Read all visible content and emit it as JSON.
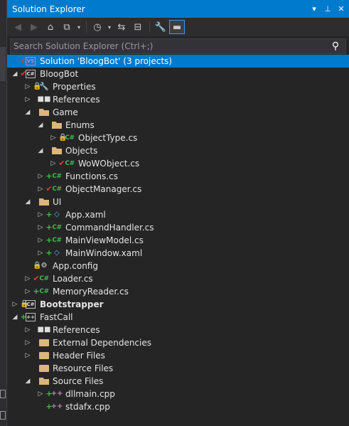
{
  "window": {
    "title": "Solution Explorer",
    "dropdown_glyph": "▾",
    "pin_glyph": "⊥",
    "close_glyph": "✕"
  },
  "toolbar": {
    "back_glyph": "◀",
    "forward_glyph": "▶",
    "home_glyph": "⌂",
    "switch_views_glyph": "⧉",
    "dropdown_glyph": "▾",
    "pending_changes_glyph": "◷",
    "sync_glyph": "⇆",
    "collapse_glyph": "⊟",
    "properties_glyph": "🔧",
    "preview_glyph": "▬"
  },
  "search": {
    "placeholder": "Search Solution Explorer (Ctrl+;)",
    "icon_glyph": "⚲"
  },
  "tree": {
    "rows": [
      {
        "text": "Solution 'BloogBot' (3 projects)",
        "depth": 0,
        "expander": "",
        "indicator": "✔",
        "indicator_kind": "check",
        "icon": "sol",
        "icon_text": "VS",
        "selected": true
      },
      {
        "text": "BloogBot",
        "depth": 0,
        "expander": "◢",
        "indicator": "✔",
        "indicator_kind": "check",
        "icon": "proj",
        "icon_text": "C#"
      },
      {
        "text": "Properties",
        "depth": 1,
        "expander": "▷",
        "indicator": "🔒",
        "indicator_kind": "lock",
        "icon": "wrench",
        "icon_text": "🔧"
      },
      {
        "text": "References",
        "depth": 1,
        "expander": "▷",
        "indicator": "",
        "indicator_kind": "",
        "icon": "refs",
        "icon_text": "■■"
      },
      {
        "text": "Game",
        "depth": 1,
        "expander": "◢",
        "indicator": "",
        "indicator_kind": "",
        "icon": "folder-open",
        "icon_text": ""
      },
      {
        "text": "Enums",
        "depth": 2,
        "expander": "◢",
        "indicator": "",
        "indicator_kind": "",
        "icon": "folder-open",
        "icon_text": ""
      },
      {
        "text": "ObjectType.cs",
        "depth": 3,
        "expander": "▷",
        "indicator": "🔒",
        "indicator_kind": "lock",
        "icon": "cs",
        "icon_text": "C#"
      },
      {
        "text": "Objects",
        "depth": 2,
        "expander": "◢",
        "indicator": "",
        "indicator_kind": "",
        "icon": "folder-open",
        "icon_text": ""
      },
      {
        "text": "WoWObject.cs",
        "depth": 3,
        "expander": "▷",
        "indicator": "✔",
        "indicator_kind": "check",
        "icon": "cs",
        "icon_text": "C#"
      },
      {
        "text": "Functions.cs",
        "depth": 2,
        "expander": "▷",
        "indicator": "+",
        "indicator_kind": "plus",
        "icon": "cs",
        "icon_text": "C#"
      },
      {
        "text": "ObjectManager.cs",
        "depth": 2,
        "expander": "▷",
        "indicator": "✔",
        "indicator_kind": "check",
        "icon": "cs",
        "icon_text": "C#"
      },
      {
        "text": "UI",
        "depth": 1,
        "expander": "◢",
        "indicator": "",
        "indicator_kind": "",
        "icon": "folder-open",
        "icon_text": ""
      },
      {
        "text": "App.xaml",
        "depth": 2,
        "expander": "▷",
        "indicator": "+",
        "indicator_kind": "plus",
        "icon": "xaml",
        "icon_text": "◇"
      },
      {
        "text": "CommandHandler.cs",
        "depth": 2,
        "expander": "▷",
        "indicator": "+",
        "indicator_kind": "plus",
        "icon": "cs",
        "icon_text": "C#"
      },
      {
        "text": "MainViewModel.cs",
        "depth": 2,
        "expander": "▷",
        "indicator": "+",
        "indicator_kind": "plus",
        "icon": "cs",
        "icon_text": "C#"
      },
      {
        "text": "MainWindow.xaml",
        "depth": 2,
        "expander": "▷",
        "indicator": "+",
        "indicator_kind": "plus",
        "icon": "xaml",
        "icon_text": "◇"
      },
      {
        "text": "App.config",
        "depth": 1,
        "expander": "",
        "indicator": "🔒",
        "indicator_kind": "lock",
        "icon": "cfg",
        "icon_text": "⚙"
      },
      {
        "text": "Loader.cs",
        "depth": 1,
        "expander": "▷",
        "indicator": "✔",
        "indicator_kind": "check",
        "icon": "cs",
        "icon_text": "C#"
      },
      {
        "text": "MemoryReader.cs",
        "depth": 1,
        "expander": "▷",
        "indicator": "+",
        "indicator_kind": "plus",
        "icon": "cs",
        "icon_text": "C#"
      },
      {
        "text": "Bootstrapper",
        "depth": 0,
        "expander": "▷",
        "indicator": "🔒",
        "indicator_kind": "lock",
        "icon": "proj",
        "icon_text": "C#",
        "bold": true
      },
      {
        "text": "FastCall",
        "depth": 0,
        "expander": "◢",
        "indicator": "+",
        "indicator_kind": "plus",
        "icon": "proj",
        "icon_text": "++"
      },
      {
        "text": "References",
        "depth": 1,
        "expander": "▷",
        "indicator": "",
        "indicator_kind": "",
        "icon": "refs",
        "icon_text": "■■"
      },
      {
        "text": "External Dependencies",
        "depth": 1,
        "expander": "▷",
        "indicator": "",
        "indicator_kind": "",
        "icon": "folder",
        "icon_text": ""
      },
      {
        "text": "Header Files",
        "depth": 1,
        "expander": "▷",
        "indicator": "",
        "indicator_kind": "",
        "icon": "folder",
        "icon_text": ""
      },
      {
        "text": "Resource Files",
        "depth": 1,
        "expander": "",
        "indicator": "",
        "indicator_kind": "",
        "icon": "folder",
        "icon_text": ""
      },
      {
        "text": "Source Files",
        "depth": 1,
        "expander": "◢",
        "indicator": "",
        "indicator_kind": "",
        "icon": "folder-open",
        "icon_text": ""
      },
      {
        "text": "dllmain.cpp",
        "depth": 2,
        "expander": "▷",
        "indicator": "+",
        "indicator_kind": "plus",
        "icon": "cpp",
        "icon_text": "++"
      },
      {
        "text": "stdafx.cpp",
        "depth": 2,
        "expander": "",
        "indicator": "+",
        "indicator_kind": "plus",
        "icon": "cpp",
        "icon_text": "++"
      }
    ]
  }
}
